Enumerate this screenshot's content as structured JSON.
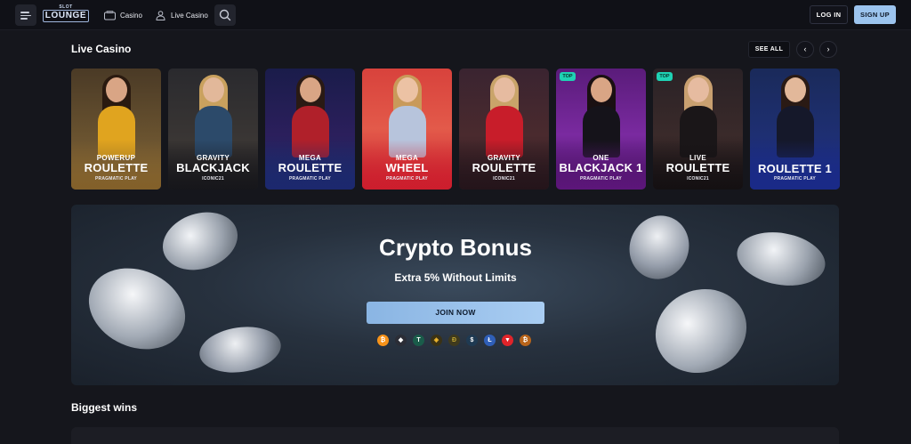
{
  "header": {
    "logo_top": "SLOT",
    "logo_main": "LOUNGE",
    "nav": [
      {
        "label": "Casino",
        "icon": "cards-icon"
      },
      {
        "label": "Live Casino",
        "icon": "dealer-icon"
      }
    ],
    "login_label": "LOG IN",
    "signup_label": "SIGN UP"
  },
  "live_casino": {
    "title": "Live Casino",
    "see_all_label": "SEE ALL",
    "prev_icon": "‹",
    "next_icon": "›",
    "tiles": [
      {
        "sub": "POWERUP",
        "name": "ROULETTE",
        "provider": "PRAGMATIC PLAY",
        "badge": ""
      },
      {
        "sub": "GRAVITY",
        "name": "BLACKJACK",
        "provider": "ICONIC21",
        "badge": ""
      },
      {
        "sub": "MEGA",
        "name": "ROULETTE",
        "provider": "PRAGMATIC PLAY",
        "badge": ""
      },
      {
        "sub": "MEGA",
        "name": "WHEEL",
        "provider": "PRAGMATIC PLAY",
        "badge": ""
      },
      {
        "sub": "GRAVITY",
        "name": "ROULETTE",
        "provider": "ICONIC21",
        "badge": ""
      },
      {
        "sub": "ONE",
        "name": "BLACKJACK 1",
        "provider": "PRAGMATIC PLAY",
        "badge": "TOP"
      },
      {
        "sub": "LIVE",
        "name": "ROULETTE",
        "provider": "ICONIC21",
        "badge": "TOP"
      },
      {
        "sub": "",
        "name": "ROULETTE 1",
        "provider": "PRAGMATIC PLAY",
        "badge": ""
      }
    ]
  },
  "banner": {
    "title": "Crypto Bonus",
    "subtitle": "Extra 5% Without Limits",
    "join_label": "JOIN NOW",
    "cryptos": [
      {
        "icon": "bitcoin-icon",
        "color": "#f7931a",
        "glyph": "₿"
      },
      {
        "icon": "ethereum-icon",
        "color": "#2b2d36",
        "glyph": "◆"
      },
      {
        "icon": "tether-icon",
        "color": "#1a5c4a",
        "glyph": "T"
      },
      {
        "icon": "bnb-icon",
        "color": "#3a3216",
        "glyph": "◈"
      },
      {
        "icon": "dogecoin-icon",
        "color": "#3f3a1d",
        "glyph": "Ð"
      },
      {
        "icon": "usdc-icon",
        "color": "#1f3a52",
        "glyph": "$"
      },
      {
        "icon": "litecoin-icon",
        "color": "#2f5fb8",
        "glyph": "Ł"
      },
      {
        "icon": "tron-icon",
        "color": "#e0242a",
        "glyph": "▼"
      },
      {
        "icon": "bitcoin-cash-icon",
        "color": "#b8641a",
        "glyph": "₿"
      }
    ]
  },
  "biggest_wins": {
    "title": "Biggest wins"
  },
  "colors": {
    "accent": "#9cc4ee",
    "background": "#15161c",
    "badge": "#1fd2b4"
  }
}
